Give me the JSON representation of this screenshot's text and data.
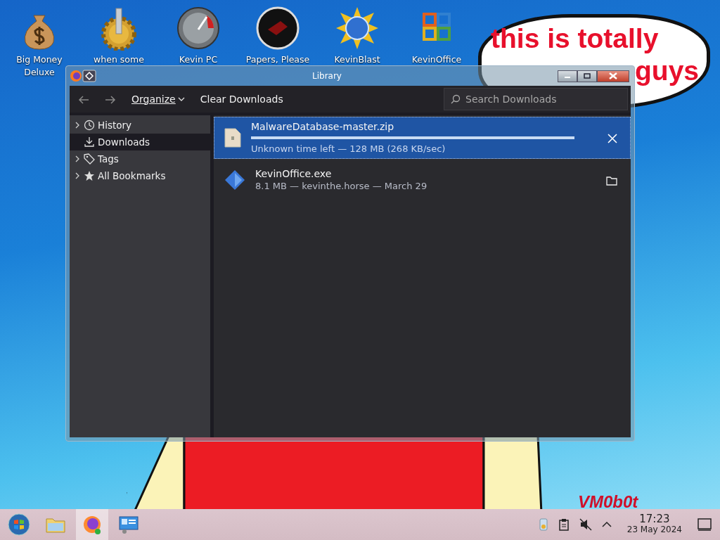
{
  "desktop_icons": [
    {
      "kind": "moneybag",
      "lines": [
        "Big Money",
        "Deluxe"
      ]
    },
    {
      "kind": "gear",
      "lines": [
        "when some"
      ]
    },
    {
      "kind": "gauge",
      "lines": [
        "Kevin PC"
      ]
    },
    {
      "kind": "disc",
      "lines": [
        "Papers, Please"
      ]
    },
    {
      "kind": "sun",
      "lines": [
        "KevinBlast"
      ]
    },
    {
      "kind": "office",
      "lines": [
        "KevinOffice"
      ]
    }
  ],
  "wallpaper": {
    "bubble_lines": [
      "this is totally",
      "guys"
    ],
    "signature": "VM0b0t"
  },
  "window": {
    "title": "Library",
    "toolbar": {
      "organize": "Organize",
      "clear": "Clear Downloads",
      "search": {
        "placeholder": "Search Downloads"
      }
    },
    "sidebar": [
      {
        "kind": "clock",
        "label": "History",
        "expandable": true,
        "selected": false
      },
      {
        "kind": "download",
        "label": "Downloads",
        "expandable": false,
        "selected": true
      },
      {
        "kind": "tag",
        "label": "Tags",
        "expandable": true,
        "selected": false
      },
      {
        "kind": "star",
        "label": "All Bookmarks",
        "expandable": true,
        "selected": false
      }
    ],
    "downloads": [
      {
        "kind": "in_progress",
        "name": "MalwareDatabase-master.zip",
        "status": "Unknown time left — 128 MB (268 KB/sec)",
        "level": 1.0,
        "selected": true
      },
      {
        "kind": "done",
        "name": "KevinOffice.exe",
        "status": "8.1 MB — kevinthe.horse — March 29",
        "selected": false
      }
    ]
  },
  "taskbar": {
    "apps": [
      {
        "kind": "start",
        "active": false
      },
      {
        "kind": "folder",
        "active": false
      },
      {
        "kind": "browser",
        "active": true
      },
      {
        "kind": "panel",
        "active": false
      }
    ],
    "time": "17:23",
    "date": "23 May 2024"
  }
}
